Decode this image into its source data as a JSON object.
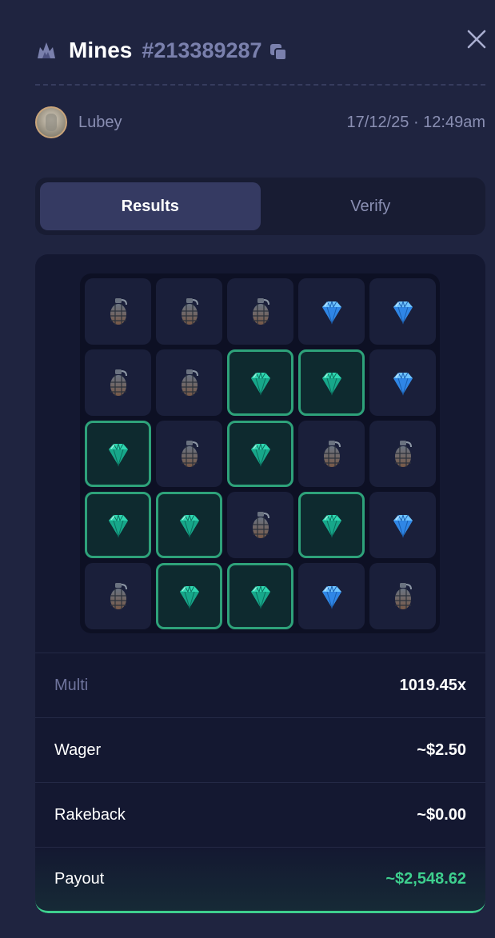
{
  "header": {
    "title": "Mines",
    "game_id": "#213389287",
    "icon": "mines-game-icon",
    "copy_icon": "copy-icon",
    "close_icon": "close-icon"
  },
  "user": {
    "name": "Lubey",
    "timestamp": "17/12/25 · 12:49am"
  },
  "tabs": [
    {
      "label": "Results",
      "active": true
    },
    {
      "label": "Verify",
      "active": false
    }
  ],
  "board": {
    "rows": 5,
    "cols": 5,
    "cells": [
      [
        "mine",
        "mine",
        "mine",
        "gem",
        "gem"
      ],
      [
        "mine",
        "mine",
        "gem-picked",
        "gem-picked",
        "gem"
      ],
      [
        "gem-picked",
        "mine",
        "gem-picked",
        "mine",
        "mine"
      ],
      [
        "gem-picked",
        "gem-picked",
        "mine",
        "gem-picked",
        "gem"
      ],
      [
        "mine",
        "gem-picked",
        "gem-picked",
        "gem",
        "mine"
      ]
    ]
  },
  "stats": {
    "multi_label": "Multi",
    "multi_value": "1019.45x",
    "wager_label": "Wager",
    "wager_value": "~$2.50",
    "rakeback_label": "Rakeback",
    "rakeback_value": "~$0.00",
    "payout_label": "Payout",
    "payout_value": "~$2,548.62"
  },
  "colors": {
    "background": "#1f2440",
    "accent_green": "#3ecf8e",
    "muted_text": "#8a8fb3",
    "active_tab": "#353a62"
  }
}
